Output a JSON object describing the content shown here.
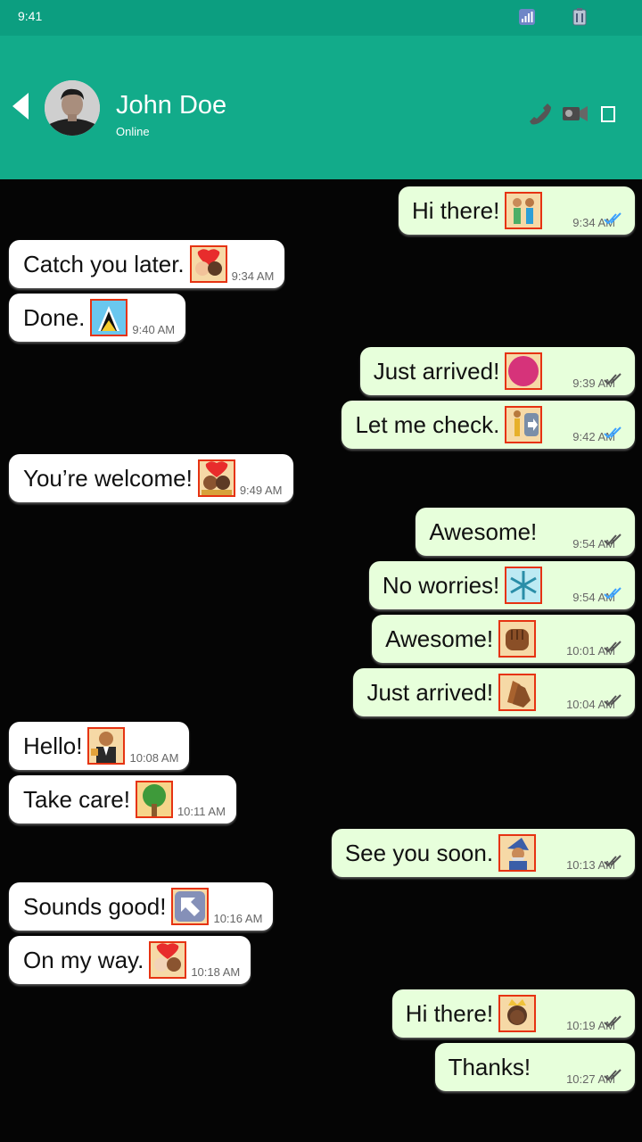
{
  "status_bar": {
    "time": "9:41"
  },
  "header": {
    "contact_name": "John Doe",
    "contact_status": "Online"
  },
  "colors": {
    "header": "#12ab8a",
    "status_bar": "#0c9e80",
    "outgoing_bubble": "#e7ffdb",
    "incoming_bubble": "#ffffff",
    "read_tick": "#3aa0ff",
    "sent_tick": "#555555"
  },
  "icons": {
    "back": "chevron-left-icon",
    "call": "phone-icon",
    "video": "video-camera-icon",
    "menu": "menu-icon",
    "signal": "signal-icon",
    "battery": "battery-icon"
  },
  "messages": [
    {
      "dir": "out",
      "text": "Hi there!",
      "emoji": "couple-holding-hands",
      "time": "9:34 AM",
      "status": "read"
    },
    {
      "dir": "in",
      "text": "Catch you later.",
      "emoji": "couple-with-heart",
      "time": "9:34 AM"
    },
    {
      "dir": "in",
      "text": "Done.",
      "emoji": "flag-saint-lucia",
      "time": "9:40 AM"
    },
    {
      "dir": "out",
      "text": "Just arrived!",
      "emoji": "red-circle",
      "time": "9:39 AM",
      "status": "sent"
    },
    {
      "dir": "out",
      "text": "Let me check.",
      "emoji": "person-walking-right",
      "time": "9:42 AM",
      "status": "read"
    },
    {
      "dir": "in",
      "text": "You’re welcome!",
      "emoji": "kiss-couple",
      "time": "9:49 AM"
    },
    {
      "dir": "out",
      "text": "Awesome!",
      "emoji": null,
      "time": "9:54 AM",
      "status": "sent"
    },
    {
      "dir": "out",
      "text": "No worries!",
      "emoji": "snowflake",
      "time": "9:54 AM",
      "status": "read"
    },
    {
      "dir": "out",
      "text": "Awesome!",
      "emoji": "oncoming-fist",
      "time": "10:01 AM",
      "status": "sent"
    },
    {
      "dir": "out",
      "text": "Just arrived!",
      "emoji": "clapping-hands",
      "time": "10:04 AM",
      "status": "sent"
    },
    {
      "dir": "in",
      "text": "Hello!",
      "emoji": "man-in-tuxedo",
      "time": "10:08 AM"
    },
    {
      "dir": "in",
      "text": "Take care!",
      "emoji": "deciduous-tree",
      "time": "10:11 AM"
    },
    {
      "dir": "out",
      "text": "See you soon.",
      "emoji": "mage",
      "time": "10:13 AM",
      "status": "sent"
    },
    {
      "dir": "in",
      "text": "Sounds good!",
      "emoji": "up-left-arrow",
      "time": "10:16 AM"
    },
    {
      "dir": "in",
      "text": "On my way.",
      "emoji": "couple-with-heart-men",
      "time": "10:18 AM"
    },
    {
      "dir": "out",
      "text": "Hi there!",
      "emoji": "princess",
      "time": "10:19 AM",
      "status": "sent"
    },
    {
      "dir": "out",
      "text": "Thanks!",
      "emoji": null,
      "time": "10:27 AM",
      "status": "sent"
    }
  ]
}
